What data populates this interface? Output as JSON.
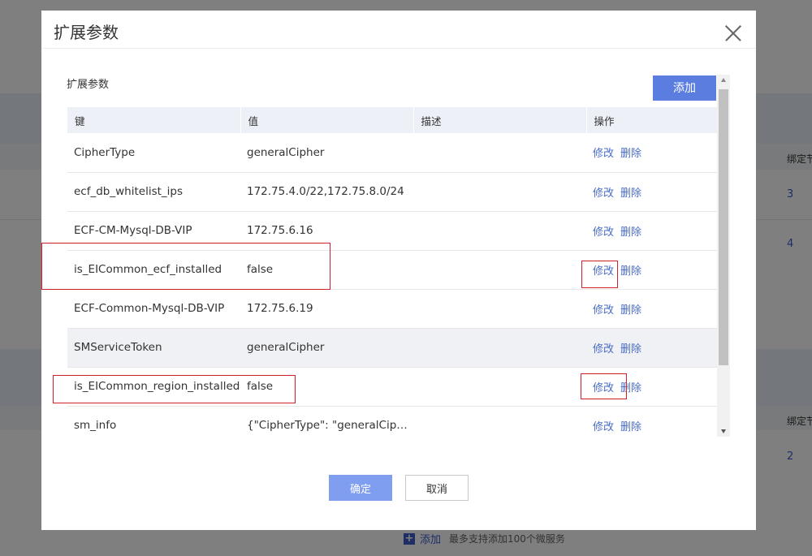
{
  "background": {
    "col_header_right_top": "绑定节",
    "col_header_right_bottom": "绑定节",
    "row_values": [
      "3",
      "4",
      "2"
    ],
    "add_label": "添加",
    "add_hint": "最多支持添加100个微服务"
  },
  "dialog": {
    "title": "扩展参数",
    "section_label": "扩展参数",
    "add_button": "添加",
    "columns": [
      "键",
      "值",
      "描述",
      "操作"
    ],
    "rows": [
      {
        "key": "CipherType",
        "value": "generalCipher",
        "desc": "",
        "edit": "修改",
        "delete": "删除"
      },
      {
        "key": "ecf_db_whitelist_ips",
        "value": "172.75.4.0/22,172.75.8.0/24",
        "desc": "",
        "edit": "修改",
        "delete": "删除"
      },
      {
        "key": "ECF-CM-Mysql-DB-VIP",
        "value": "172.75.6.16",
        "desc": "",
        "edit": "修改",
        "delete": "删除"
      },
      {
        "key": "is_EICommon_ecf_installed",
        "value": "false",
        "desc": "",
        "edit": "修改",
        "delete": "删除"
      },
      {
        "key": "ECF-Common-Mysql-DB-VIP",
        "value": "172.75.6.19",
        "desc": "",
        "edit": "修改",
        "delete": "删除"
      },
      {
        "key": "SMServiceToken",
        "value": "generalCipher",
        "desc": "",
        "edit": "修改",
        "delete": "删除"
      },
      {
        "key": "is_EICommon_region_installed",
        "value": "false",
        "desc": "",
        "edit": "修改",
        "delete": "删除"
      },
      {
        "key": "sm_info",
        "value": "{\"CipherType\": \"generalCiph...",
        "desc": "",
        "edit": "修改",
        "delete": "删除"
      }
    ],
    "confirm_button": "确定",
    "cancel_button": "取消"
  },
  "colors": {
    "primary": "#5b7de0",
    "primary_disabled": "#7f9ef0",
    "link": "#4a6cc9",
    "highlight_box": "#d0212a",
    "header_bg": "#edf0f7"
  }
}
